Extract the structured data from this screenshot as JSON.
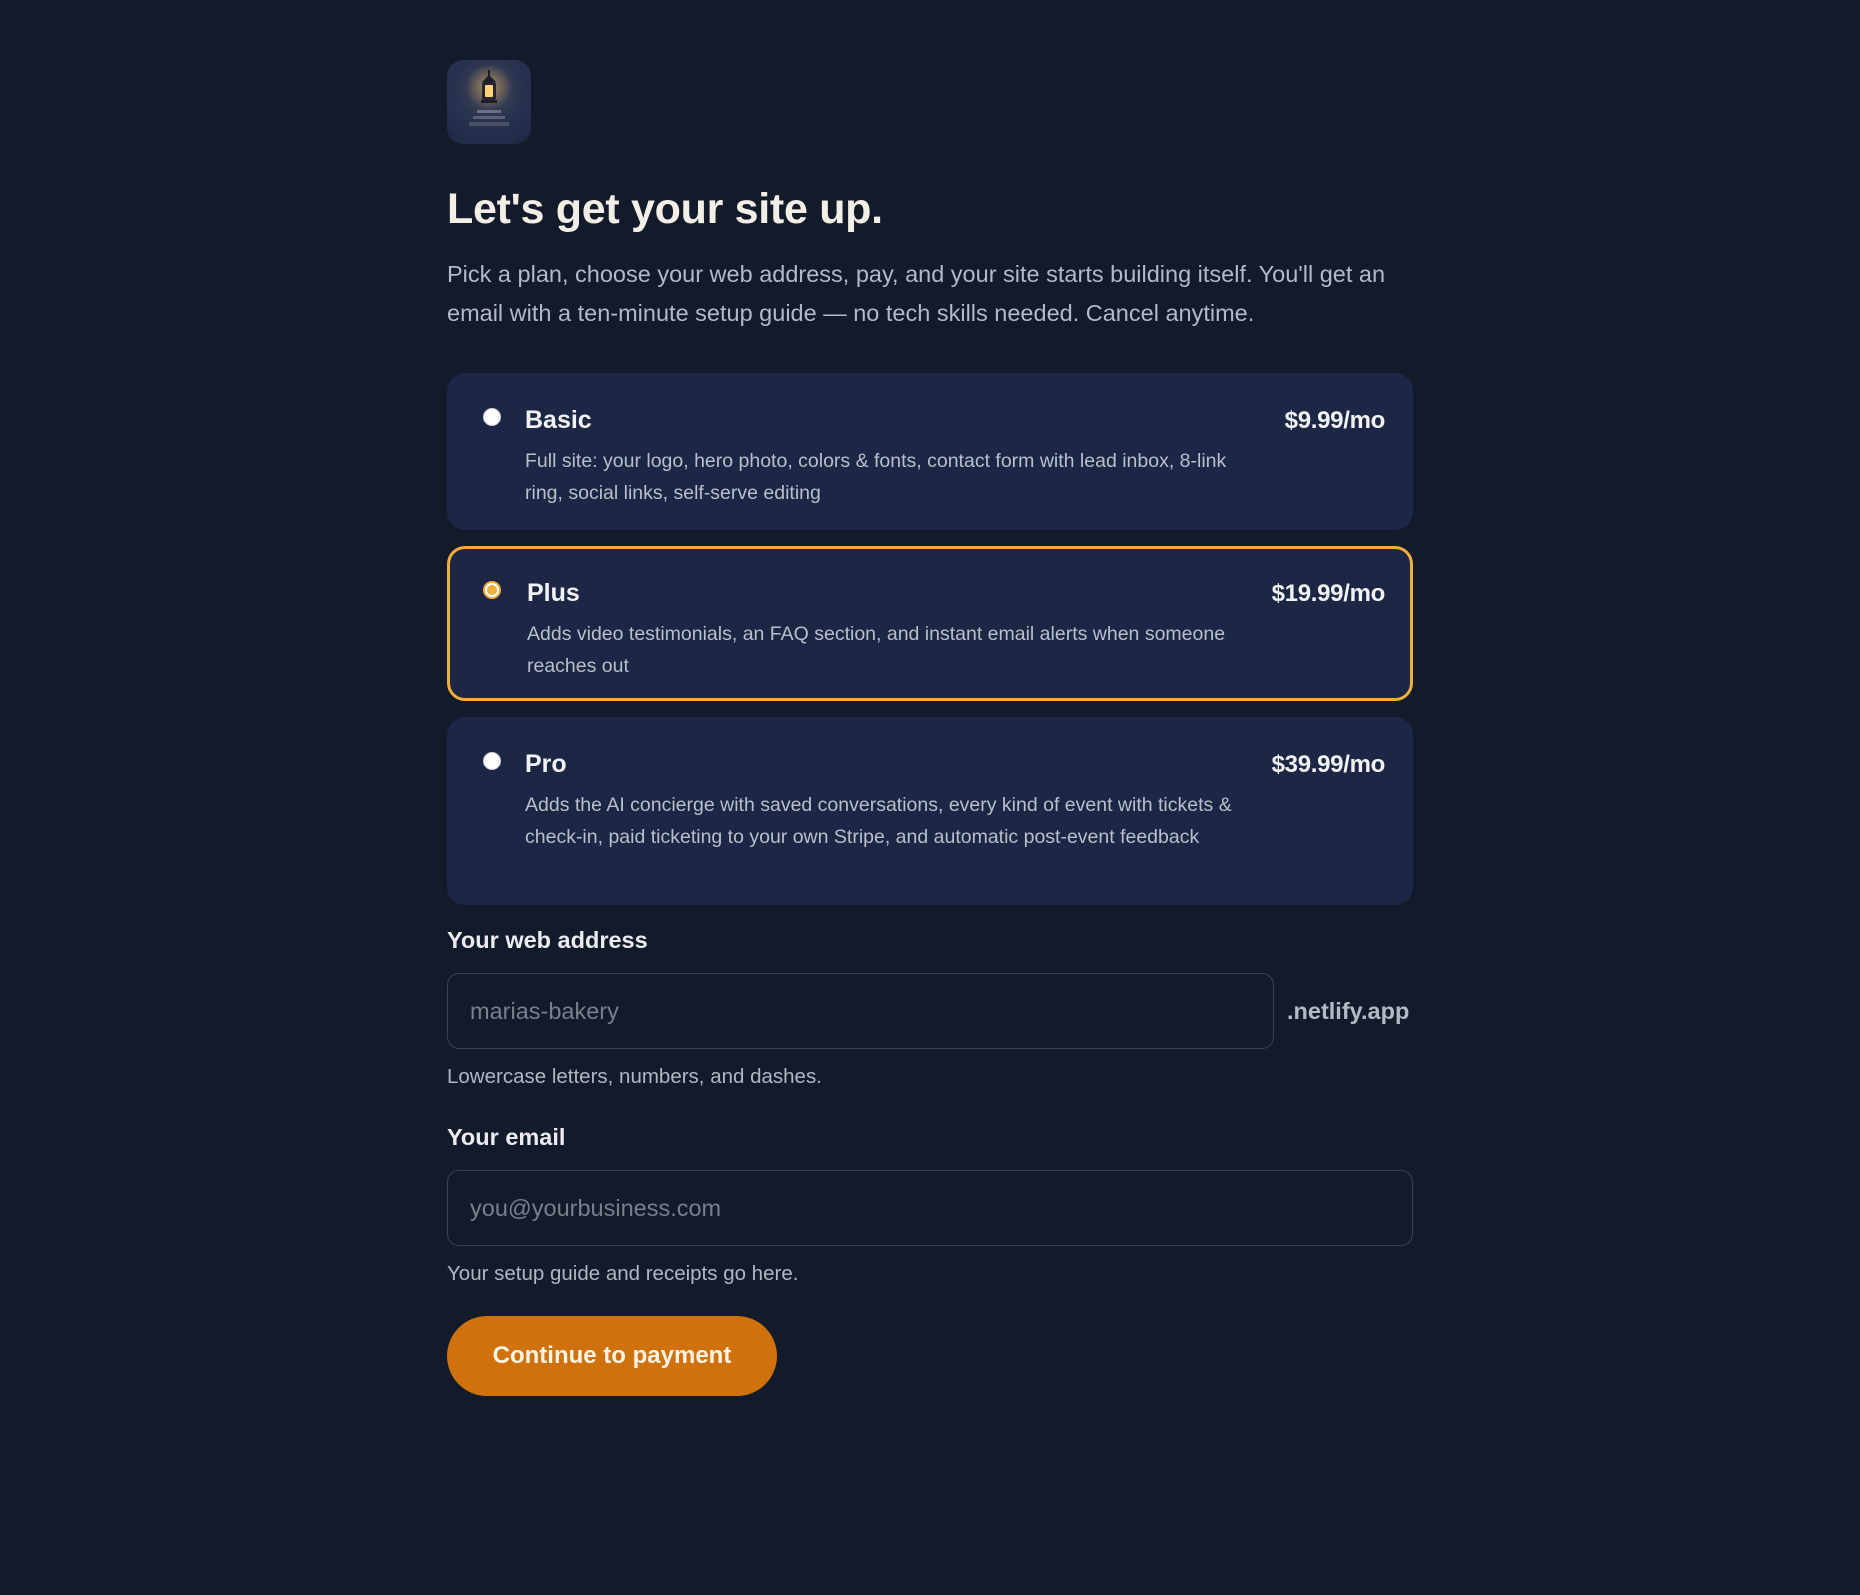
{
  "brand": {
    "logo_icon": "lighthouse-lantern-icon"
  },
  "header": {
    "title": "Let's get your site up.",
    "subtitle": "Pick a plan, choose your web address, pay, and your site starts building itself. You'll get an email with a ten-minute setup guide — no tech skills needed. Cancel anytime."
  },
  "plans": [
    {
      "name": "Basic",
      "price": "$9.99/mo",
      "description": "Full site: your logo, hero photo, colors & fonts, contact form with lead inbox, 8-link ring, social links, self-serve editing",
      "selected": false
    },
    {
      "name": "Plus",
      "price": "$19.99/mo",
      "description": "Adds video testimonials, an FAQ section, and instant email alerts when someone reaches out",
      "selected": true
    },
    {
      "name": "Pro",
      "price": "$39.99/mo",
      "description": "Adds the AI concierge with saved conversations, every kind of event with tickets & check-in, paid ticketing to your own Stripe, and automatic post-event feedback",
      "selected": false
    }
  ],
  "web_address": {
    "label": "Your web address",
    "value": "",
    "placeholder": "marias-bakery",
    "suffix": ".netlify.app",
    "hint": "Lowercase letters, numbers, and dashes."
  },
  "email": {
    "label": "Your email",
    "value": "",
    "placeholder": "you@yourbusiness.com",
    "hint": "Your setup guide and receipts go here."
  },
  "cta": {
    "label": "Continue to payment"
  },
  "colors": {
    "background": "#131a2a",
    "card": "#1d2644",
    "accent": "#f0ad3c",
    "button": "#cf720d"
  }
}
